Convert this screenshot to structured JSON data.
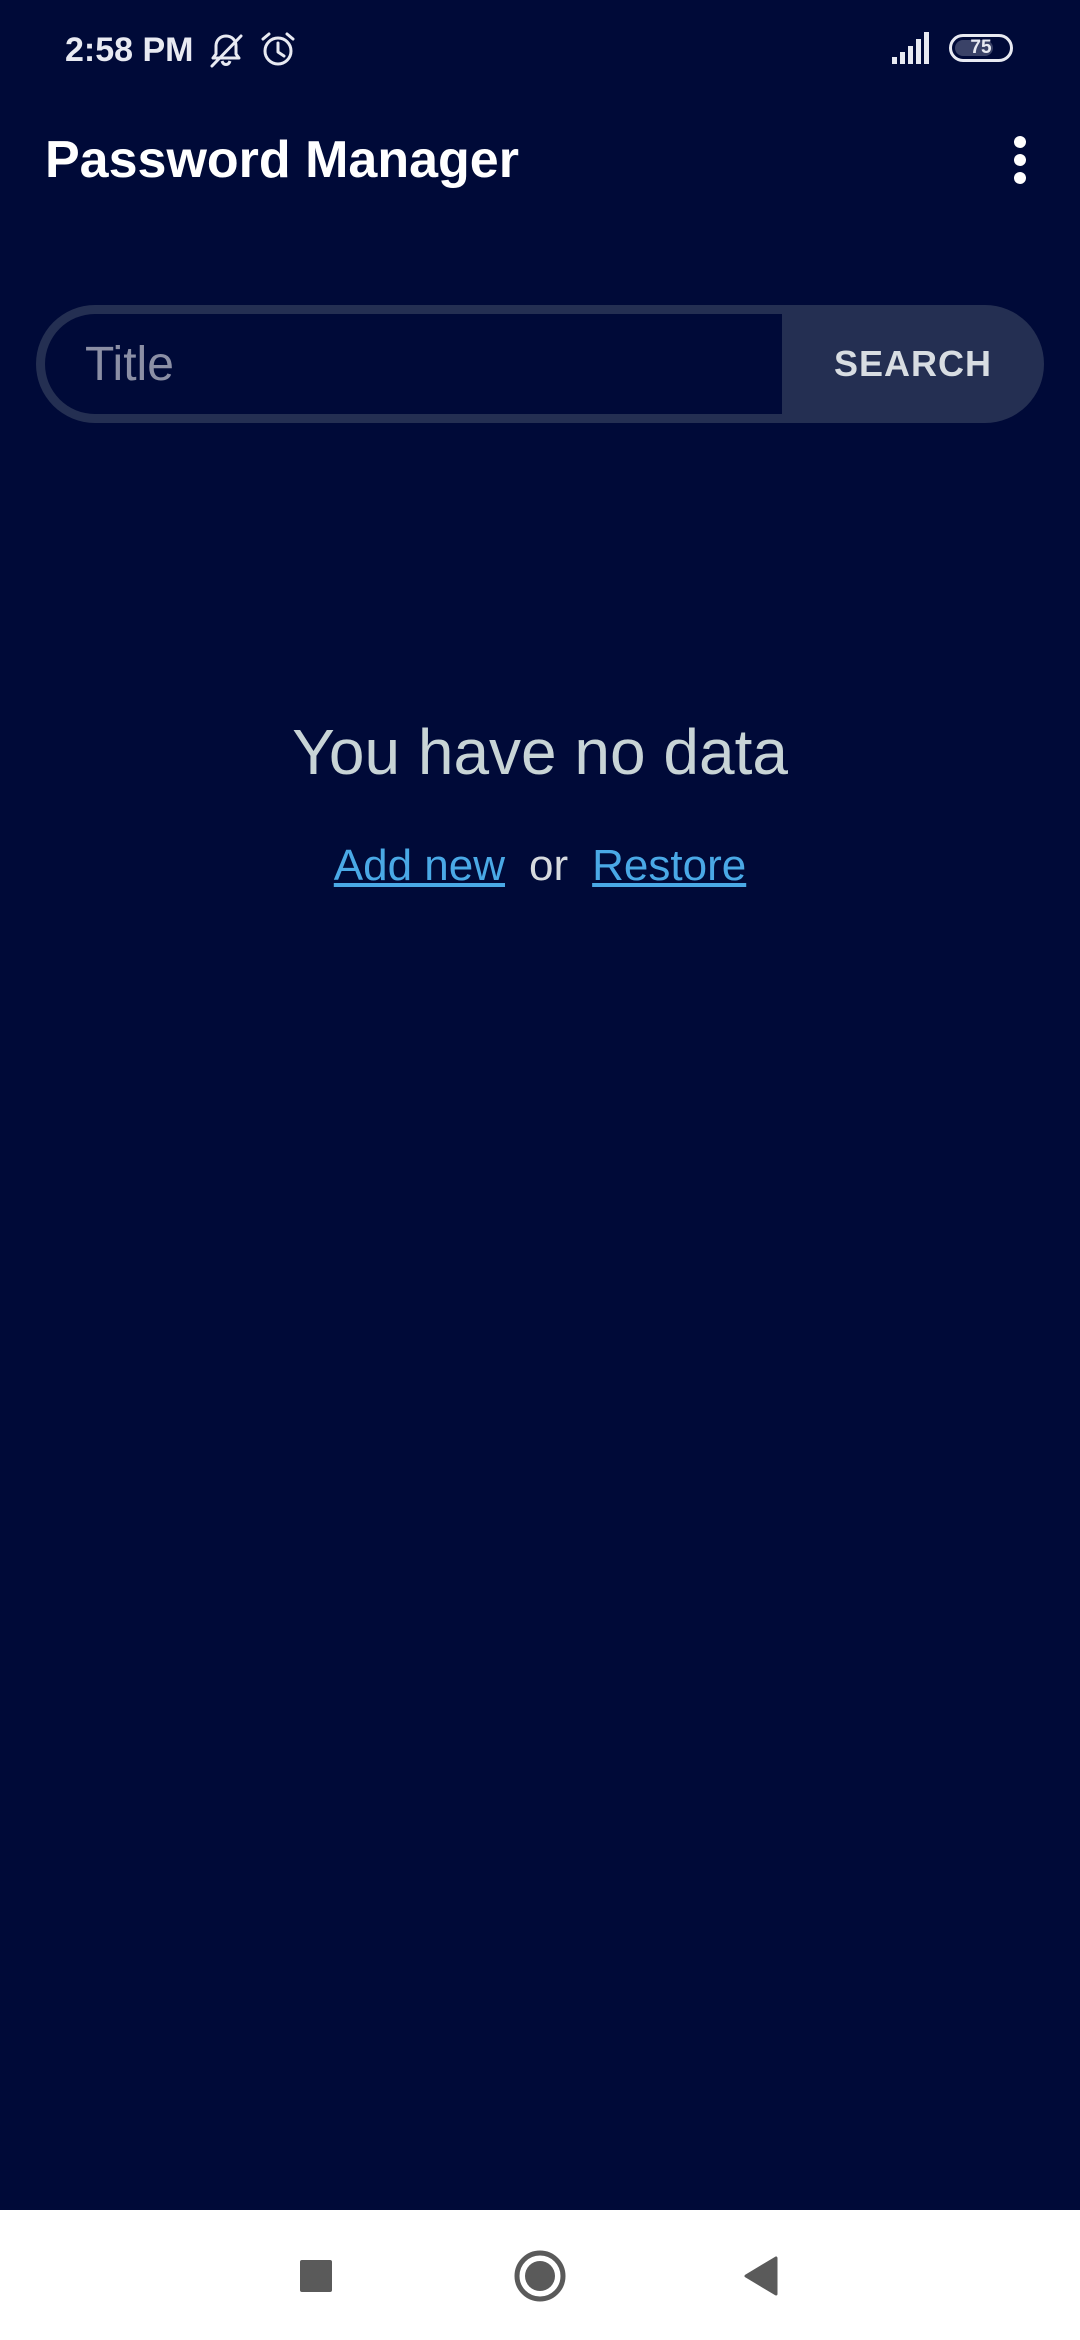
{
  "status_bar": {
    "time": "2:58 PM",
    "icons": [
      "bell-off-icon",
      "alarm-icon",
      "signal-icon",
      "battery-icon"
    ],
    "battery_level": "75",
    "battery_fraction": 0.75
  },
  "app_bar": {
    "title": "Password Manager",
    "menu_icon": "more-vertical-icon"
  },
  "search": {
    "placeholder": "Title",
    "value": "",
    "button_label": "SEARCH"
  },
  "empty_state": {
    "title": "You have no data",
    "add_new_label": "Add new",
    "separator": "or",
    "restore_label": "Restore"
  },
  "nav_bar": {
    "buttons": [
      "recents-square-icon",
      "home-circle-icon",
      "back-triangle-icon"
    ]
  },
  "colors": {
    "background": "#000a38",
    "search_button_bg": "#242f52",
    "link": "#4aa9e6",
    "empty_text": "#c8d4d6",
    "nav_bg": "#ffffff"
  }
}
